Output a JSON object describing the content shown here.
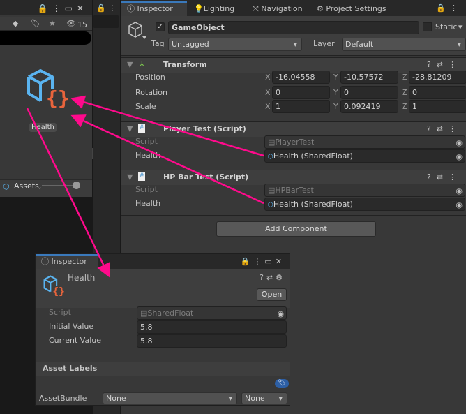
{
  "project_panel": {
    "filter_count": "15",
    "asset_label": "Health",
    "footer_path": "Assets,",
    "slider_value": 0.9
  },
  "inspector": {
    "tabs": [
      {
        "label": "Inspector",
        "icon": "info-icon"
      },
      {
        "label": "Lighting",
        "icon": "bulb-icon"
      },
      {
        "label": "Navigation",
        "icon": "navigation-icon"
      },
      {
        "label": "Project Settings",
        "icon": "gear-icon"
      }
    ],
    "object": {
      "name": "GameObject",
      "active": true,
      "static_label": "Static",
      "static": false,
      "tag_label": "Tag",
      "tag": "Untagged",
      "layer_label": "Layer",
      "layer": "Default"
    },
    "transform": {
      "title": "Transform",
      "rows": [
        {
          "label": "Position",
          "x": "-16.04558",
          "y": "-10.57572",
          "z": "-28.81209"
        },
        {
          "label": "Rotation",
          "x": "0",
          "y": "0",
          "z": "0"
        },
        {
          "label": "Scale",
          "x": "1",
          "y": "0.092419",
          "z": "1"
        }
      ],
      "axes": [
        "X",
        "Y",
        "Z"
      ]
    },
    "components": [
      {
        "title": "Player Test (Script)",
        "script_label": "Script",
        "script": "PlayerTest",
        "field_label": "Health",
        "field_value": "Health (SharedFloat)"
      },
      {
        "title": "HP Bar Test (Script)",
        "script_label": "Script",
        "script": "HPBarTest",
        "field_label": "Health",
        "field_value": "Health (SharedFloat)"
      }
    ],
    "add_component": "Add Component"
  },
  "floating_inspector": {
    "tab": "Inspector",
    "asset_name": "Health",
    "open_label": "Open",
    "script_label": "Script",
    "script": "SharedFloat",
    "fields": [
      {
        "label": "Initial Value",
        "value": "5.8"
      },
      {
        "label": "Current Value",
        "value": "5.8"
      }
    ],
    "asset_labels_title": "Asset Labels",
    "assetbundle_label": "AssetBundle",
    "bundle": "None",
    "variant": "None"
  },
  "colors": {
    "accent": "#3a79bb",
    "arrow": "#ff0a8c",
    "cube": "#5ab4f0",
    "braces": "#e8643c"
  }
}
